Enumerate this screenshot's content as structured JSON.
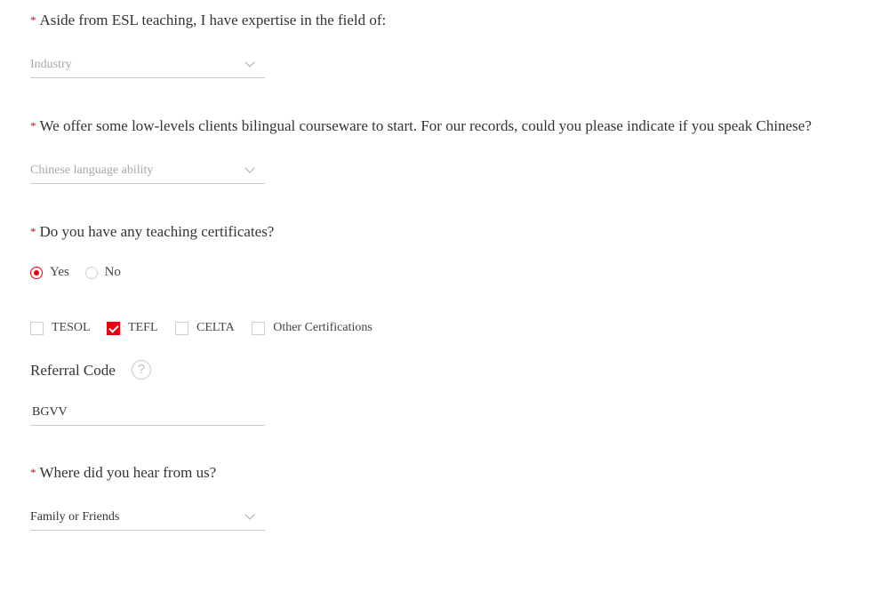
{
  "q_industry": {
    "required_mark": "*",
    "question": "Aside from ESL teaching, I have expertise in the field of:",
    "select_placeholder": "Industry"
  },
  "q_chinese": {
    "required_mark": "*",
    "question": "We offer some low-levels clients bilingual courseware to start. For our records, could you please indicate if you speak Chinese?",
    "select_placeholder": "Chinese language ability"
  },
  "q_certificates": {
    "required_mark": "*",
    "question": "Do you have any teaching certificates?",
    "options": {
      "yes": "Yes",
      "no": "No"
    },
    "selected": "Yes",
    "certifications": [
      {
        "label": "TESOL",
        "checked": false
      },
      {
        "label": "TEFL",
        "checked": true
      },
      {
        "label": "CELTA",
        "checked": false
      },
      {
        "label": "Other Certifications",
        "checked": false
      }
    ]
  },
  "referral": {
    "label": "Referral Code",
    "help_glyph": "?",
    "value": "BGVV"
  },
  "q_source": {
    "required_mark": "*",
    "question": "Where did you hear from us?",
    "selected_value": "Family or Friends"
  },
  "colors": {
    "accent": "#e60012",
    "text": "#333333",
    "placeholder": "#a9a9a9",
    "underline": "#c9c9c9"
  }
}
